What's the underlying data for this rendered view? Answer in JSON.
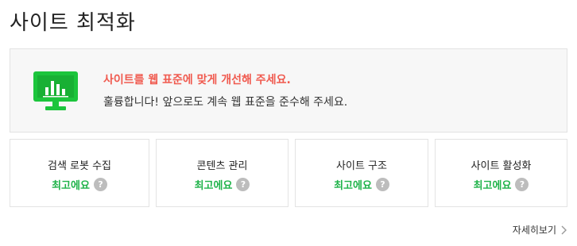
{
  "page": {
    "title": "사이트 최적화"
  },
  "summary": {
    "icon": "monitor-chart-icon",
    "headline": "사이트를 웹 표준에 맞게 개선해 주세요.",
    "description": "훌륭합니다! 앞으로도 계속 웹 표준을 준수해 주세요.",
    "headline_color": "#f05a4f",
    "icon_color": "#1cc53c"
  },
  "cards": [
    {
      "title": "검색 로봇 수집",
      "status": "최고에요",
      "help_icon": "?"
    },
    {
      "title": "콘텐츠 관리",
      "status": "최고에요",
      "help_icon": "?"
    },
    {
      "title": "사이트 구조",
      "status": "최고에요",
      "help_icon": "?"
    },
    {
      "title": "사이트 활성화",
      "status": "최고에요",
      "help_icon": "?"
    }
  ],
  "status_color": "#20b34a",
  "footer": {
    "details_label": "자세히보기"
  }
}
